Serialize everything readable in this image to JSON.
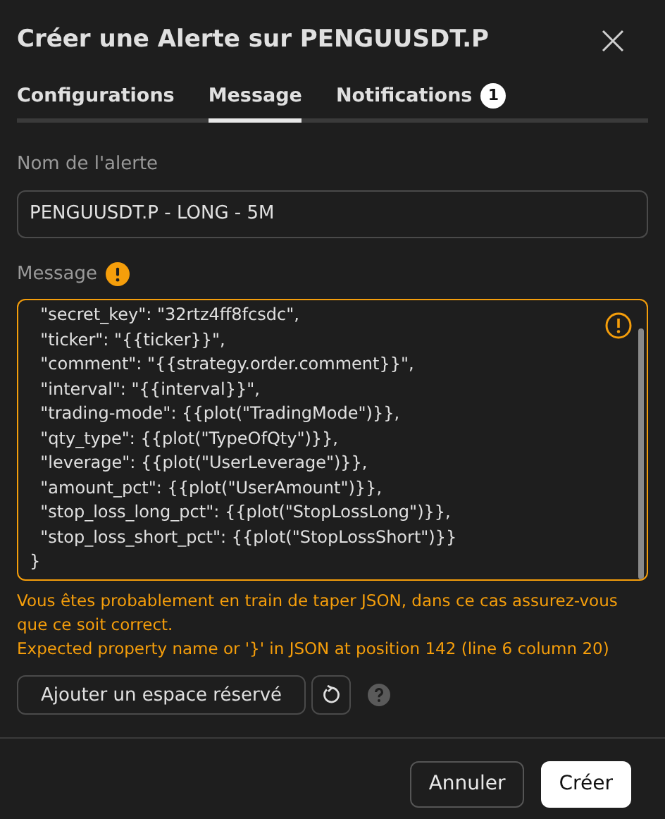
{
  "dialog": {
    "title": "Créer une Alerte sur PENGUUSDT.P"
  },
  "tabs": [
    {
      "label": "Configurations",
      "selected": false
    },
    {
      "label": "Message",
      "selected": true
    },
    {
      "label": "Notifications",
      "selected": false,
      "badge": "1"
    }
  ],
  "name_field": {
    "label": "Nom de l'alerte",
    "value": "PENGUUSDT.P - LONG - 5M"
  },
  "message_field": {
    "label": "Message",
    "warning": true,
    "lines": [
      "  \"secret_key\": \"32rtz4ff8fcsdc\",",
      "  \"ticker\": \"{{ticker}}\",",
      "  \"comment\": \"{{strategy.order.comment}}\",",
      "  \"interval\": \"{{interval}}\",",
      "  \"trading-mode\": {{plot(\"TradingMode\")}},",
      "  \"qty_type\": {{plot(\"TypeOfQty\")}},",
      "  \"leverage\": {{plot(\"UserLeverage\")}},",
      "  \"amount_pct\": {{plot(\"UserAmount\")}},",
      "  \"stop_loss_long_pct\": {{plot(\"StopLossLong\")}},",
      "  \"stop_loss_short_pct\": {{plot(\"StopLossShort\")}}",
      "}"
    ]
  },
  "warnings": [
    "Vous êtes probablement en train de taper JSON, dans ce cas assurez-vous que ce soit correct.",
    "Expected property name or '}' in JSON at position 142 (line 6 column 20)"
  ],
  "placeholder_button": "Ajouter un espace réservé",
  "buttons": [
    {
      "label": "Annuler",
      "kind": "secondary"
    },
    {
      "label": "Créer",
      "kind": "primary"
    }
  ]
}
